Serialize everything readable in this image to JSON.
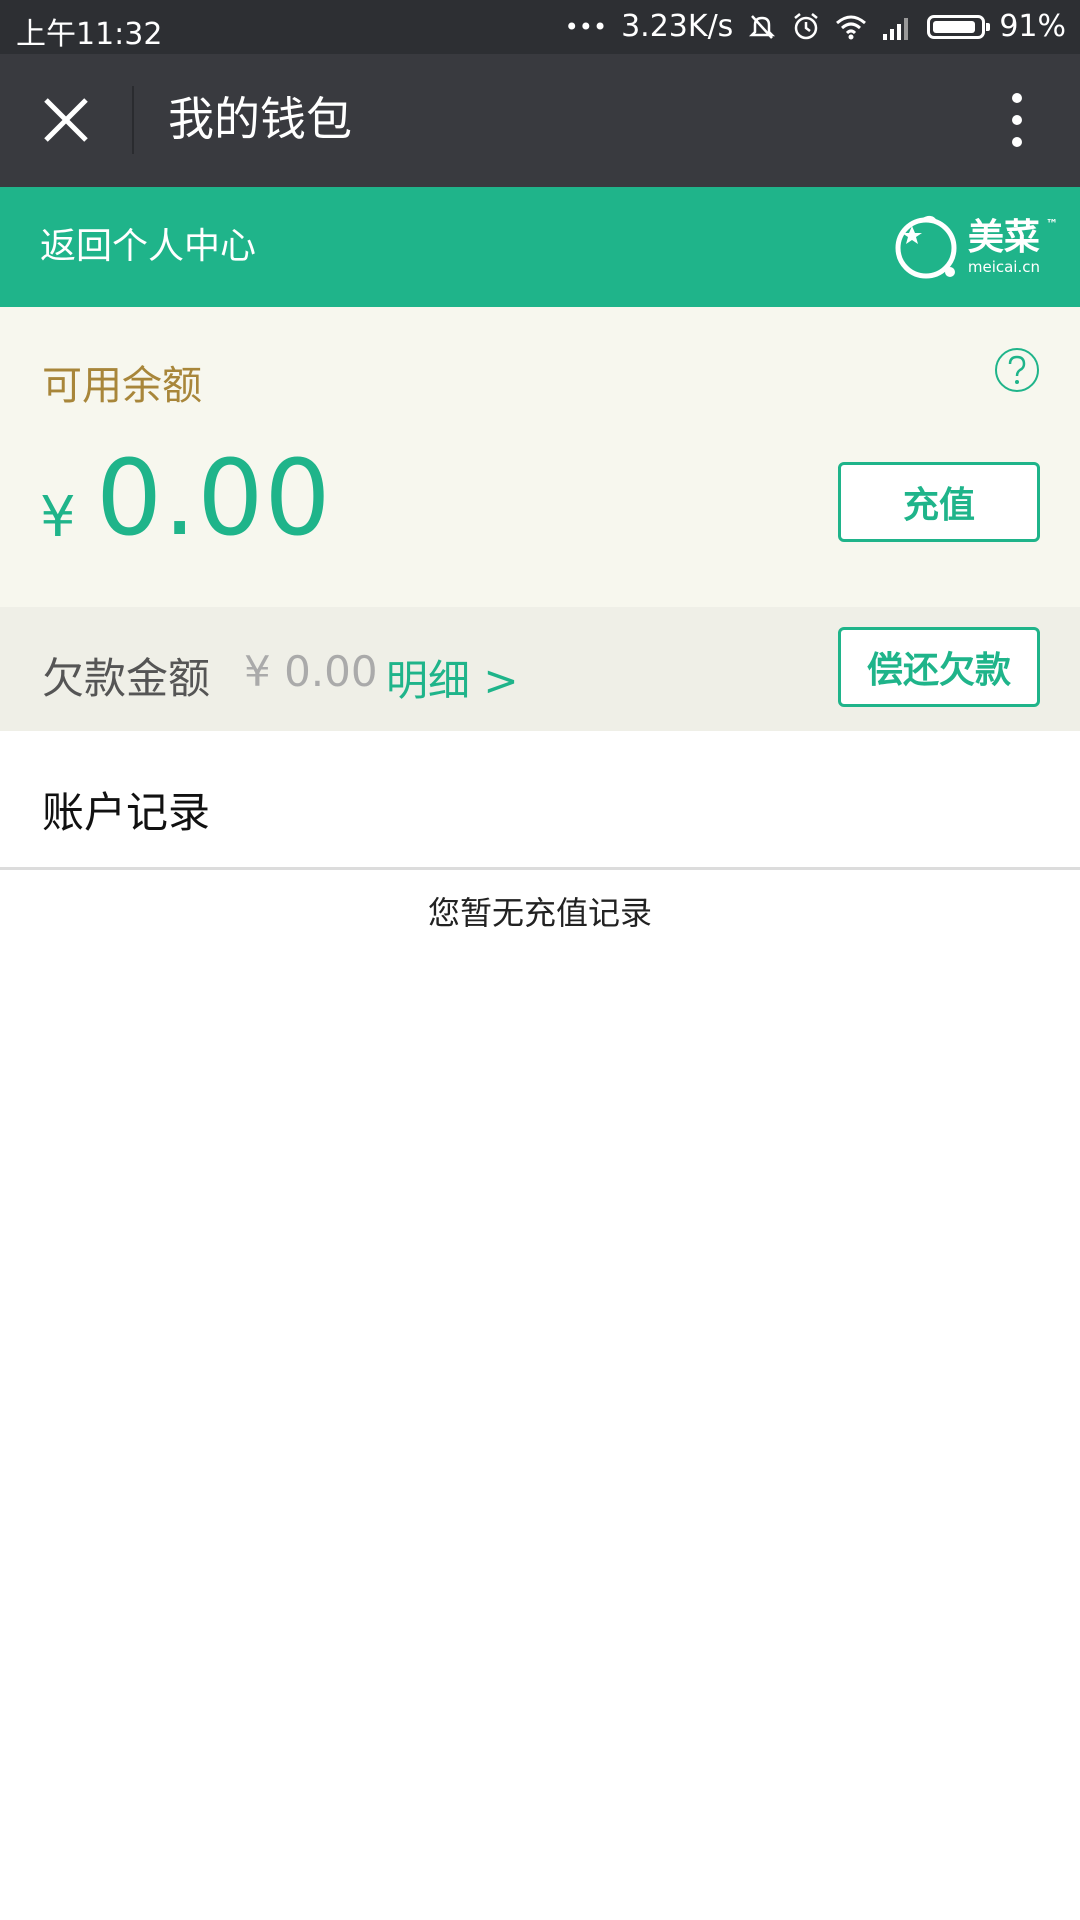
{
  "status_bar": {
    "time": "上午11:32",
    "dots": "•••",
    "network_speed": "3.23K/s",
    "battery": "91%",
    "battery_level": 0.91,
    "icons": [
      "mute-bell-icon",
      "alarm-icon",
      "wifi-icon",
      "signal-icon",
      "battery-icon"
    ]
  },
  "title_bar": {
    "title": "我的钱包",
    "close_icon": "close-icon",
    "more_icon": "more-vertical-icon"
  },
  "header": {
    "back_link": "返回个人中心",
    "logo_cn": "美菜",
    "logo_tm": "™",
    "logo_en": "meicai.cn"
  },
  "balance": {
    "label": "可用余额",
    "currency": "¥",
    "amount": "0.00",
    "recharge_label": "充值",
    "help_icon": "question-circle-icon"
  },
  "debt": {
    "label": "欠款金额",
    "amount": "¥ 0.00",
    "detail_link": "明细 >",
    "repay_label": "偿还欠款"
  },
  "records": {
    "title": "账户记录",
    "empty_message": "您暂无充值记录"
  },
  "colors": {
    "accent": "#1fb48a",
    "title_bar": "#393a3f",
    "status_bar": "#2d2f33",
    "balance_bg": "#f7f7ee",
    "debt_bg": "#efefe7",
    "label_gold": "#a8863a"
  }
}
